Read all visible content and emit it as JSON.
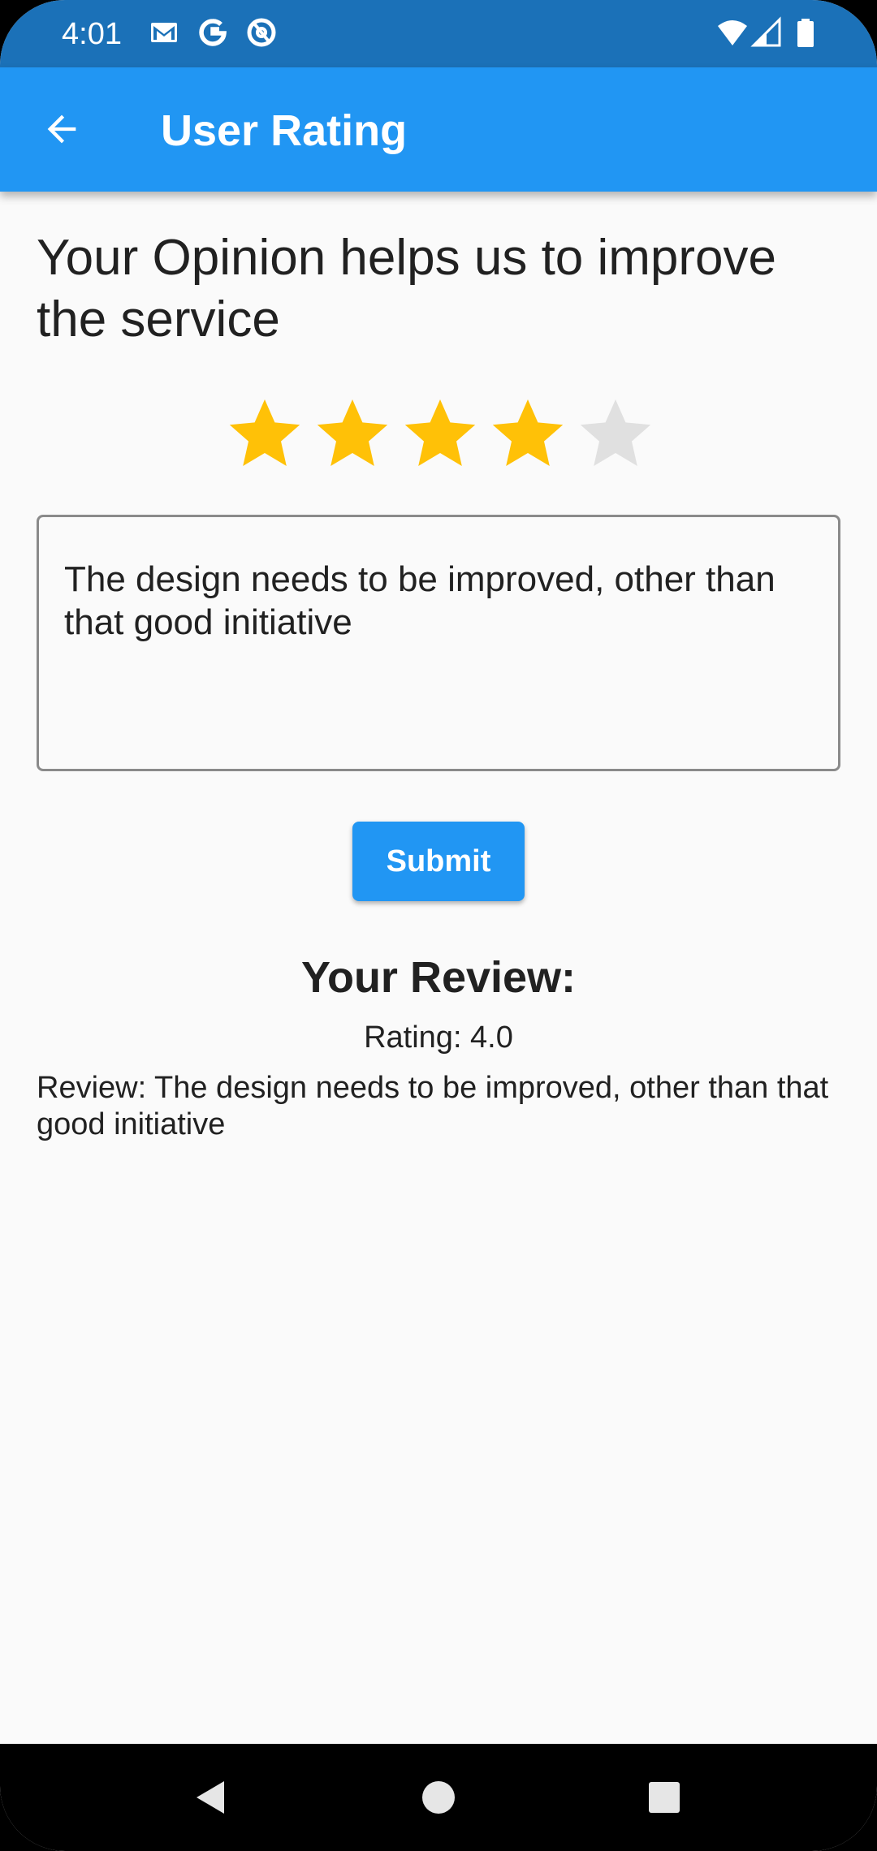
{
  "status_bar": {
    "time": "4:01",
    "left_icons": [
      "gmail-icon",
      "google-icon",
      "at-sign-icon"
    ],
    "right_icons": [
      "wifi-icon",
      "signal-icon",
      "battery-icon"
    ]
  },
  "app_bar": {
    "title": "User Rating",
    "back_icon": "arrow-back-icon"
  },
  "main": {
    "headline": "Your Opinion helps us to improve the service",
    "rating": {
      "value": 4,
      "max": 5,
      "filled_color": "#FFC107",
      "empty_color": "#E0E0E0"
    },
    "review_input": {
      "value": "The design needs to be improved, other than that good initiative"
    },
    "submit_label": "Submit",
    "result": {
      "heading": "Your Review:",
      "rating_text": "Rating: 4.0",
      "review_text": "Review: The design needs to be improved, other than that good initiative"
    }
  },
  "nav_bar": {
    "buttons": [
      "back-triangle-icon",
      "home-circle-icon",
      "recents-square-icon"
    ]
  },
  "colors": {
    "primary": "#2196F3",
    "status_bar": "#1B71B8",
    "background": "#FAFAFA",
    "text": "#212121"
  }
}
